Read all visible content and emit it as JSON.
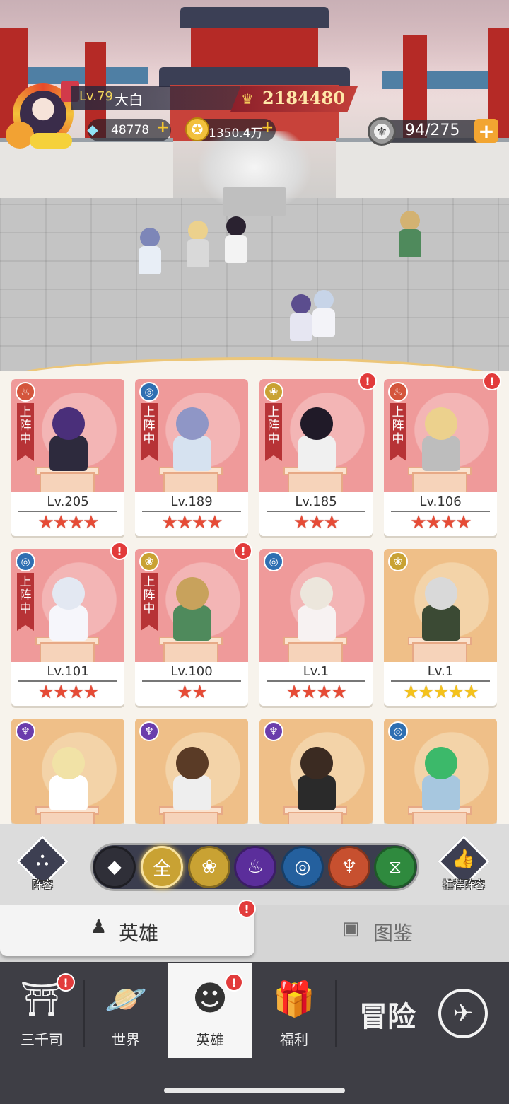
{
  "hud": {
    "player_level": "Lv.79",
    "player_name": "大白",
    "power": "2184480",
    "diamonds": "48778",
    "gold": "1350.4万",
    "stamina": "94/275",
    "plus": "+"
  },
  "heroes": [
    {
      "level": "Lv.205",
      "stars": 4,
      "star_color": "red",
      "faction": "fire",
      "on_duty": true,
      "alert": false,
      "bg": "pink"
    },
    {
      "level": "Lv.189",
      "stars": 4,
      "star_color": "red",
      "faction": "water",
      "on_duty": true,
      "alert": false,
      "bg": "pink"
    },
    {
      "level": "Lv.185",
      "stars": 3,
      "star_color": "red",
      "faction": "lotus",
      "on_duty": true,
      "alert": true,
      "bg": "pink"
    },
    {
      "level": "Lv.106",
      "stars": 4,
      "star_color": "red",
      "faction": "fire",
      "on_duty": true,
      "alert": true,
      "bg": "pink"
    },
    {
      "level": "Lv.101",
      "stars": 4,
      "star_color": "red",
      "faction": "water",
      "on_duty": true,
      "alert": true,
      "bg": "pink"
    },
    {
      "level": "Lv.100",
      "stars": 2,
      "star_color": "red",
      "faction": "lotus",
      "on_duty": true,
      "alert": true,
      "bg": "pink"
    },
    {
      "level": "Lv.1",
      "stars": 4,
      "star_color": "red",
      "faction": "water",
      "on_duty": false,
      "alert": false,
      "bg": "pink"
    },
    {
      "level": "Lv.1",
      "stars": 5,
      "star_color": "gold",
      "faction": "lotus",
      "on_duty": false,
      "alert": false,
      "bg": "gold"
    },
    {
      "level": "",
      "stars": 0,
      "star_color": "red",
      "faction": "dark",
      "on_duty": false,
      "alert": false,
      "bg": "gold"
    },
    {
      "level": "",
      "stars": 0,
      "star_color": "red",
      "faction": "dark",
      "on_duty": false,
      "alert": false,
      "bg": "gold"
    },
    {
      "level": "",
      "stars": 0,
      "star_color": "red",
      "faction": "dark",
      "on_duty": false,
      "alert": false,
      "bg": "gold"
    },
    {
      "level": "",
      "stars": 0,
      "star_color": "red",
      "faction": "water",
      "on_duty": false,
      "alert": false,
      "bg": "gold"
    }
  ],
  "on_duty_label": "上阵中",
  "filters": {
    "lineup_label": "阵容",
    "recommend_label": "推荐阵容",
    "options": [
      {
        "icon": "diamond-stack-icon",
        "glyph": "◆",
        "color": "#2f2f38"
      },
      {
        "icon": "all-text",
        "glyph": "全",
        "color": "#c9a233",
        "selected": true
      },
      {
        "icon": "lotus-icon",
        "glyph": "❀",
        "color": "#c9a233"
      },
      {
        "icon": "dark-flame-icon",
        "glyph": "♨",
        "color": "#5b2e9b"
      },
      {
        "icon": "water-swirl-icon",
        "glyph": "◎",
        "color": "#24609e"
      },
      {
        "icon": "fire-meditation-icon",
        "glyph": "♆",
        "color": "#c7502f"
      },
      {
        "icon": "dna-icon",
        "glyph": "⧖",
        "color": "#2f8a3e"
      }
    ]
  },
  "subtabs": {
    "heroes_label": "英雄",
    "codex_label": "图鉴"
  },
  "nav": {
    "items": [
      {
        "label": "三千司",
        "icon": "tower-icon",
        "glyph": "⛩",
        "alert": true
      },
      {
        "label": "世界",
        "icon": "planet-icon",
        "glyph": "🪐",
        "alert": false
      },
      {
        "label": "英雄",
        "icon": "hero-head-icon",
        "glyph": "☻",
        "alert": true,
        "active": true
      },
      {
        "label": "福利",
        "icon": "gift-box-icon",
        "glyph": "🎁",
        "alert": false
      }
    ],
    "adventure_label": "冒险",
    "adventure_icon": "compass-icon"
  },
  "colors": {
    "alert": "#e23b3b",
    "star_red": "#e64b36",
    "star_gold": "#f4c21c",
    "on_duty_ribbon": "#b73336"
  }
}
